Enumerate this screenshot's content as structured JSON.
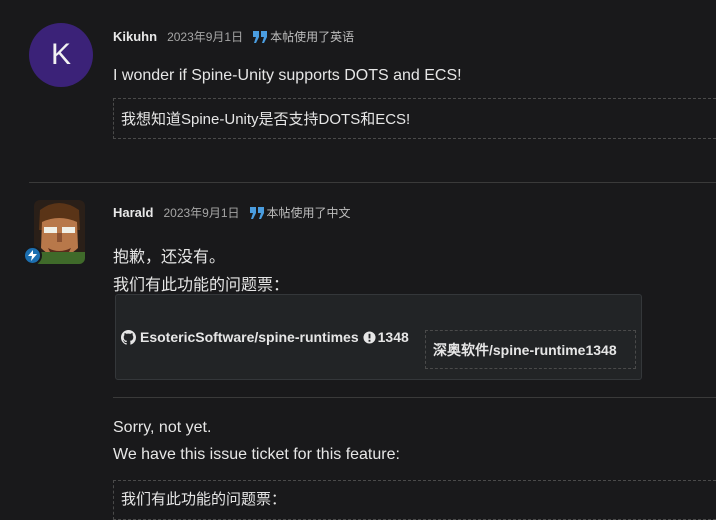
{
  "post1": {
    "avatar_letter": "K",
    "author": "Kikuhn",
    "date": "2023年9月1日",
    "language_note": "本帖使用了英语",
    "body": "I wonder if Spine-Unity supports DOTS and ECS!",
    "translation": "我想知道Spine-Unity是否支持DOTS和ECS!"
  },
  "post2": {
    "author": "Harald",
    "date": "2023年9月1日",
    "language_note": "本帖使用了中文",
    "body_line1": "抱歉，还没有。",
    "body_line2": "我们有此功能的问题票：",
    "link_card": {
      "repo": "EsotericSoftware/spine-runtimes",
      "issue_number": "1348",
      "translation": "深奥软件/spine-runtime1348"
    },
    "translated_line1": "Sorry, not yet.",
    "translated_line2": "We have this issue ticket for this feature:",
    "translation_box": "我们有此功能的问题票："
  },
  "colors": {
    "background": "#19191b",
    "avatar_bg": "#3b2278",
    "quote_icon": "#4a9de0",
    "badge": "#1c6fb0"
  },
  "icons": [
    "quote-icon",
    "github-icon",
    "issue-icon",
    "bolt-icon"
  ]
}
